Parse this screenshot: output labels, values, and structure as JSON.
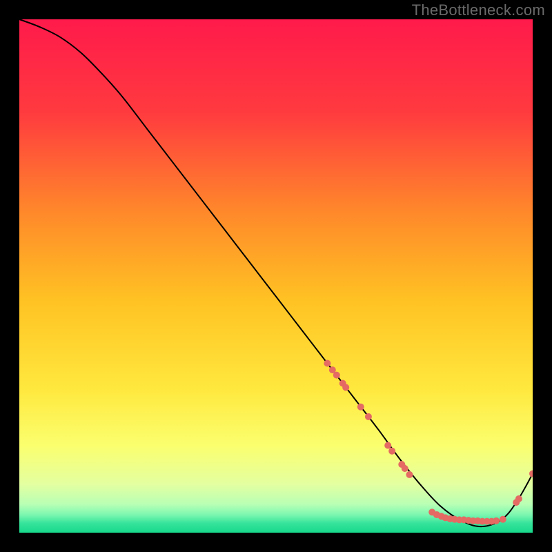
{
  "watermark": "TheBottleneck.com",
  "chart_data": {
    "type": "line",
    "title": "",
    "xlabel": "",
    "ylabel": "",
    "xlim": [
      0,
      100
    ],
    "ylim": [
      0,
      100
    ],
    "background_gradient": {
      "stops": [
        {
          "offset": 0.0,
          "color": "#ff1a4b"
        },
        {
          "offset": 0.18,
          "color": "#ff3a3f"
        },
        {
          "offset": 0.38,
          "color": "#ff8a2a"
        },
        {
          "offset": 0.55,
          "color": "#ffc323"
        },
        {
          "offset": 0.72,
          "color": "#ffe83e"
        },
        {
          "offset": 0.83,
          "color": "#fbff6e"
        },
        {
          "offset": 0.905,
          "color": "#e4ffa0"
        },
        {
          "offset": 0.945,
          "color": "#b8ffb5"
        },
        {
          "offset": 0.965,
          "color": "#7cf7b0"
        },
        {
          "offset": 0.982,
          "color": "#35e39a"
        },
        {
          "offset": 1.0,
          "color": "#17d98c"
        }
      ]
    },
    "series": [
      {
        "name": "curve",
        "color": "#000000",
        "x": [
          0,
          4,
          8,
          12,
          16,
          20,
          25,
          30,
          35,
          40,
          45,
          50,
          55,
          60,
          65,
          70,
          74,
          78,
          82,
          86,
          90,
          94,
          97,
          100
        ],
        "y": [
          100,
          98.5,
          96.5,
          93.5,
          89.5,
          85,
          78.5,
          72,
          65.5,
          59,
          52.5,
          46,
          39.5,
          33,
          26.5,
          20,
          14.5,
          9.5,
          5.2,
          2.4,
          1.2,
          2.6,
          6.2,
          11.5
        ]
      }
    ],
    "markers": {
      "name": "highlight-points",
      "color": "#e46a63",
      "radius": 5,
      "points": [
        {
          "x": 60.0,
          "y": 33.0
        },
        {
          "x": 61.0,
          "y": 31.7
        },
        {
          "x": 61.8,
          "y": 30.7
        },
        {
          "x": 63.0,
          "y": 29.1
        },
        {
          "x": 63.6,
          "y": 28.3
        },
        {
          "x": 66.5,
          "y": 24.5
        },
        {
          "x": 68.0,
          "y": 22.6
        },
        {
          "x": 71.8,
          "y": 17.0
        },
        {
          "x": 72.6,
          "y": 15.9
        },
        {
          "x": 74.5,
          "y": 13.3
        },
        {
          "x": 75.1,
          "y": 12.5
        },
        {
          "x": 76.0,
          "y": 11.3
        },
        {
          "x": 80.4,
          "y": 4.0
        },
        {
          "x": 81.3,
          "y": 3.5
        },
        {
          "x": 82.2,
          "y": 3.2
        },
        {
          "x": 83.0,
          "y": 2.9
        },
        {
          "x": 83.9,
          "y": 2.7
        },
        {
          "x": 84.8,
          "y": 2.6
        },
        {
          "x": 85.7,
          "y": 2.5
        },
        {
          "x": 86.6,
          "y": 2.5
        },
        {
          "x": 87.5,
          "y": 2.4
        },
        {
          "x": 88.4,
          "y": 2.3
        },
        {
          "x": 89.3,
          "y": 2.3
        },
        {
          "x": 90.2,
          "y": 2.2
        },
        {
          "x": 91.1,
          "y": 2.2
        },
        {
          "x": 92.0,
          "y": 2.2
        },
        {
          "x": 92.9,
          "y": 2.3
        },
        {
          "x": 94.2,
          "y": 2.6
        },
        {
          "x": 96.8,
          "y": 5.9
        },
        {
          "x": 97.3,
          "y": 6.6
        },
        {
          "x": 100.0,
          "y": 11.5
        }
      ]
    }
  }
}
